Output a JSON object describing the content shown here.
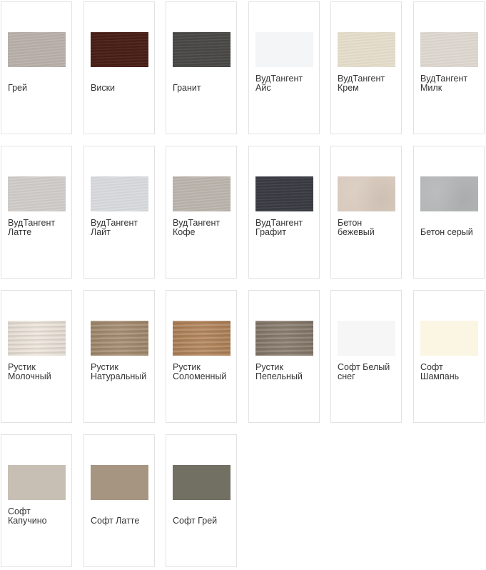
{
  "swatches": [
    {
      "label": "Грей",
      "color": "#b7afa8",
      "pattern": "wood-light"
    },
    {
      "label": "Виски",
      "color": "#4a1f16",
      "pattern": "wood-dark"
    },
    {
      "label": "Гранит",
      "color": "#4b4a48",
      "pattern": "wood-dark"
    },
    {
      "label": "ВудТангент\nАйс",
      "color": "#f4f5f7",
      "pattern": "plain"
    },
    {
      "label": "ВудТангент\nКрем",
      "color": "#e4ddca",
      "pattern": "wood-light"
    },
    {
      "label": "ВудТангент\nМилк",
      "color": "#ddd7cf",
      "pattern": "wood-light"
    },
    {
      "label": "ВудТангент\nЛатте",
      "color": "#cfcbc8",
      "pattern": "wood-light"
    },
    {
      "label": "ВудТангент\nЛайт",
      "color": "#d7d9dc",
      "pattern": "wood-light"
    },
    {
      "label": "ВудТангент\nКофе",
      "color": "#b9b3ab",
      "pattern": "wood-light"
    },
    {
      "label": "ВудТангент\nГрафит",
      "color": "#3b3d44",
      "pattern": "wood-dark"
    },
    {
      "label": "Бетон\nбежевый",
      "color": "#d8cabd",
      "pattern": "concrete"
    },
    {
      "label": "Бетон серый",
      "color": "#b3b5b6",
      "pattern": "concrete"
    },
    {
      "label": "Рустик\nМолочный",
      "color": "#eee6dc",
      "pattern": "rustic"
    },
    {
      "label": "Рустик\nНатуральный",
      "color": "#a58c6f",
      "pattern": "rustic"
    },
    {
      "label": "Рустик\nСоломенный",
      "color": "#b3845a",
      "pattern": "rustic"
    },
    {
      "label": "Рустик\nПепельный",
      "color": "#877a6c",
      "pattern": "rustic"
    },
    {
      "label": "Софт Белый\nснег",
      "color": "#f6f6f6",
      "pattern": "plain"
    },
    {
      "label": "Софт\nШампань",
      "color": "#fbf5e3",
      "pattern": "plain"
    },
    {
      "label": "Софт\nКапучино",
      "color": "#c8bfb4",
      "pattern": "plain"
    },
    {
      "label": "Софт Латте",
      "color": "#a69580",
      "pattern": "plain"
    },
    {
      "label": "Софт Грей",
      "color": "#727063",
      "pattern": "plain"
    }
  ]
}
